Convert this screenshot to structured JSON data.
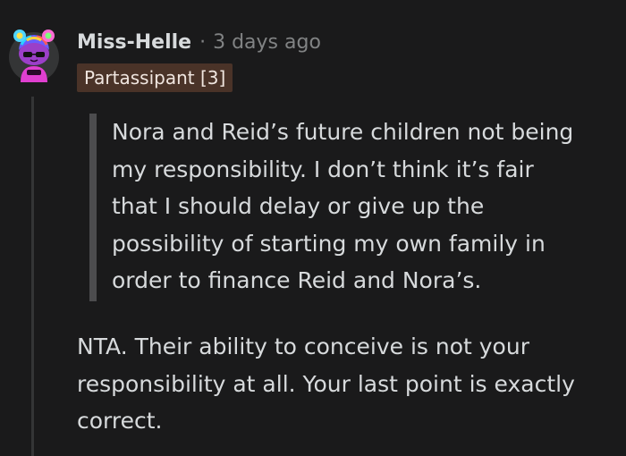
{
  "comment": {
    "author": "Miss-Helle",
    "separator": "·",
    "timestamp": "3 days ago",
    "flair": "Partassipant [3]",
    "avatar_icon": "snoo-avatar-icon",
    "quote_lines": [
      "Nora and Reid’s future children not being",
      "my responsibility. I don’t think it’s fair",
      "that I should delay or give up the",
      "possibility of starting my own family in",
      "order to finance Reid and Nora’s."
    ],
    "body_lines": [
      "NTA. Their ability to conceive is not your",
      "responsibility at all. Your last point is exactly",
      "correct."
    ]
  },
  "colors": {
    "background": "#1a1a1b",
    "text": "#d7dadc",
    "muted": "#818384",
    "flair_bg": "#4a3328",
    "quote_bar": "#4c4c4e",
    "thread_line": "#343536"
  }
}
